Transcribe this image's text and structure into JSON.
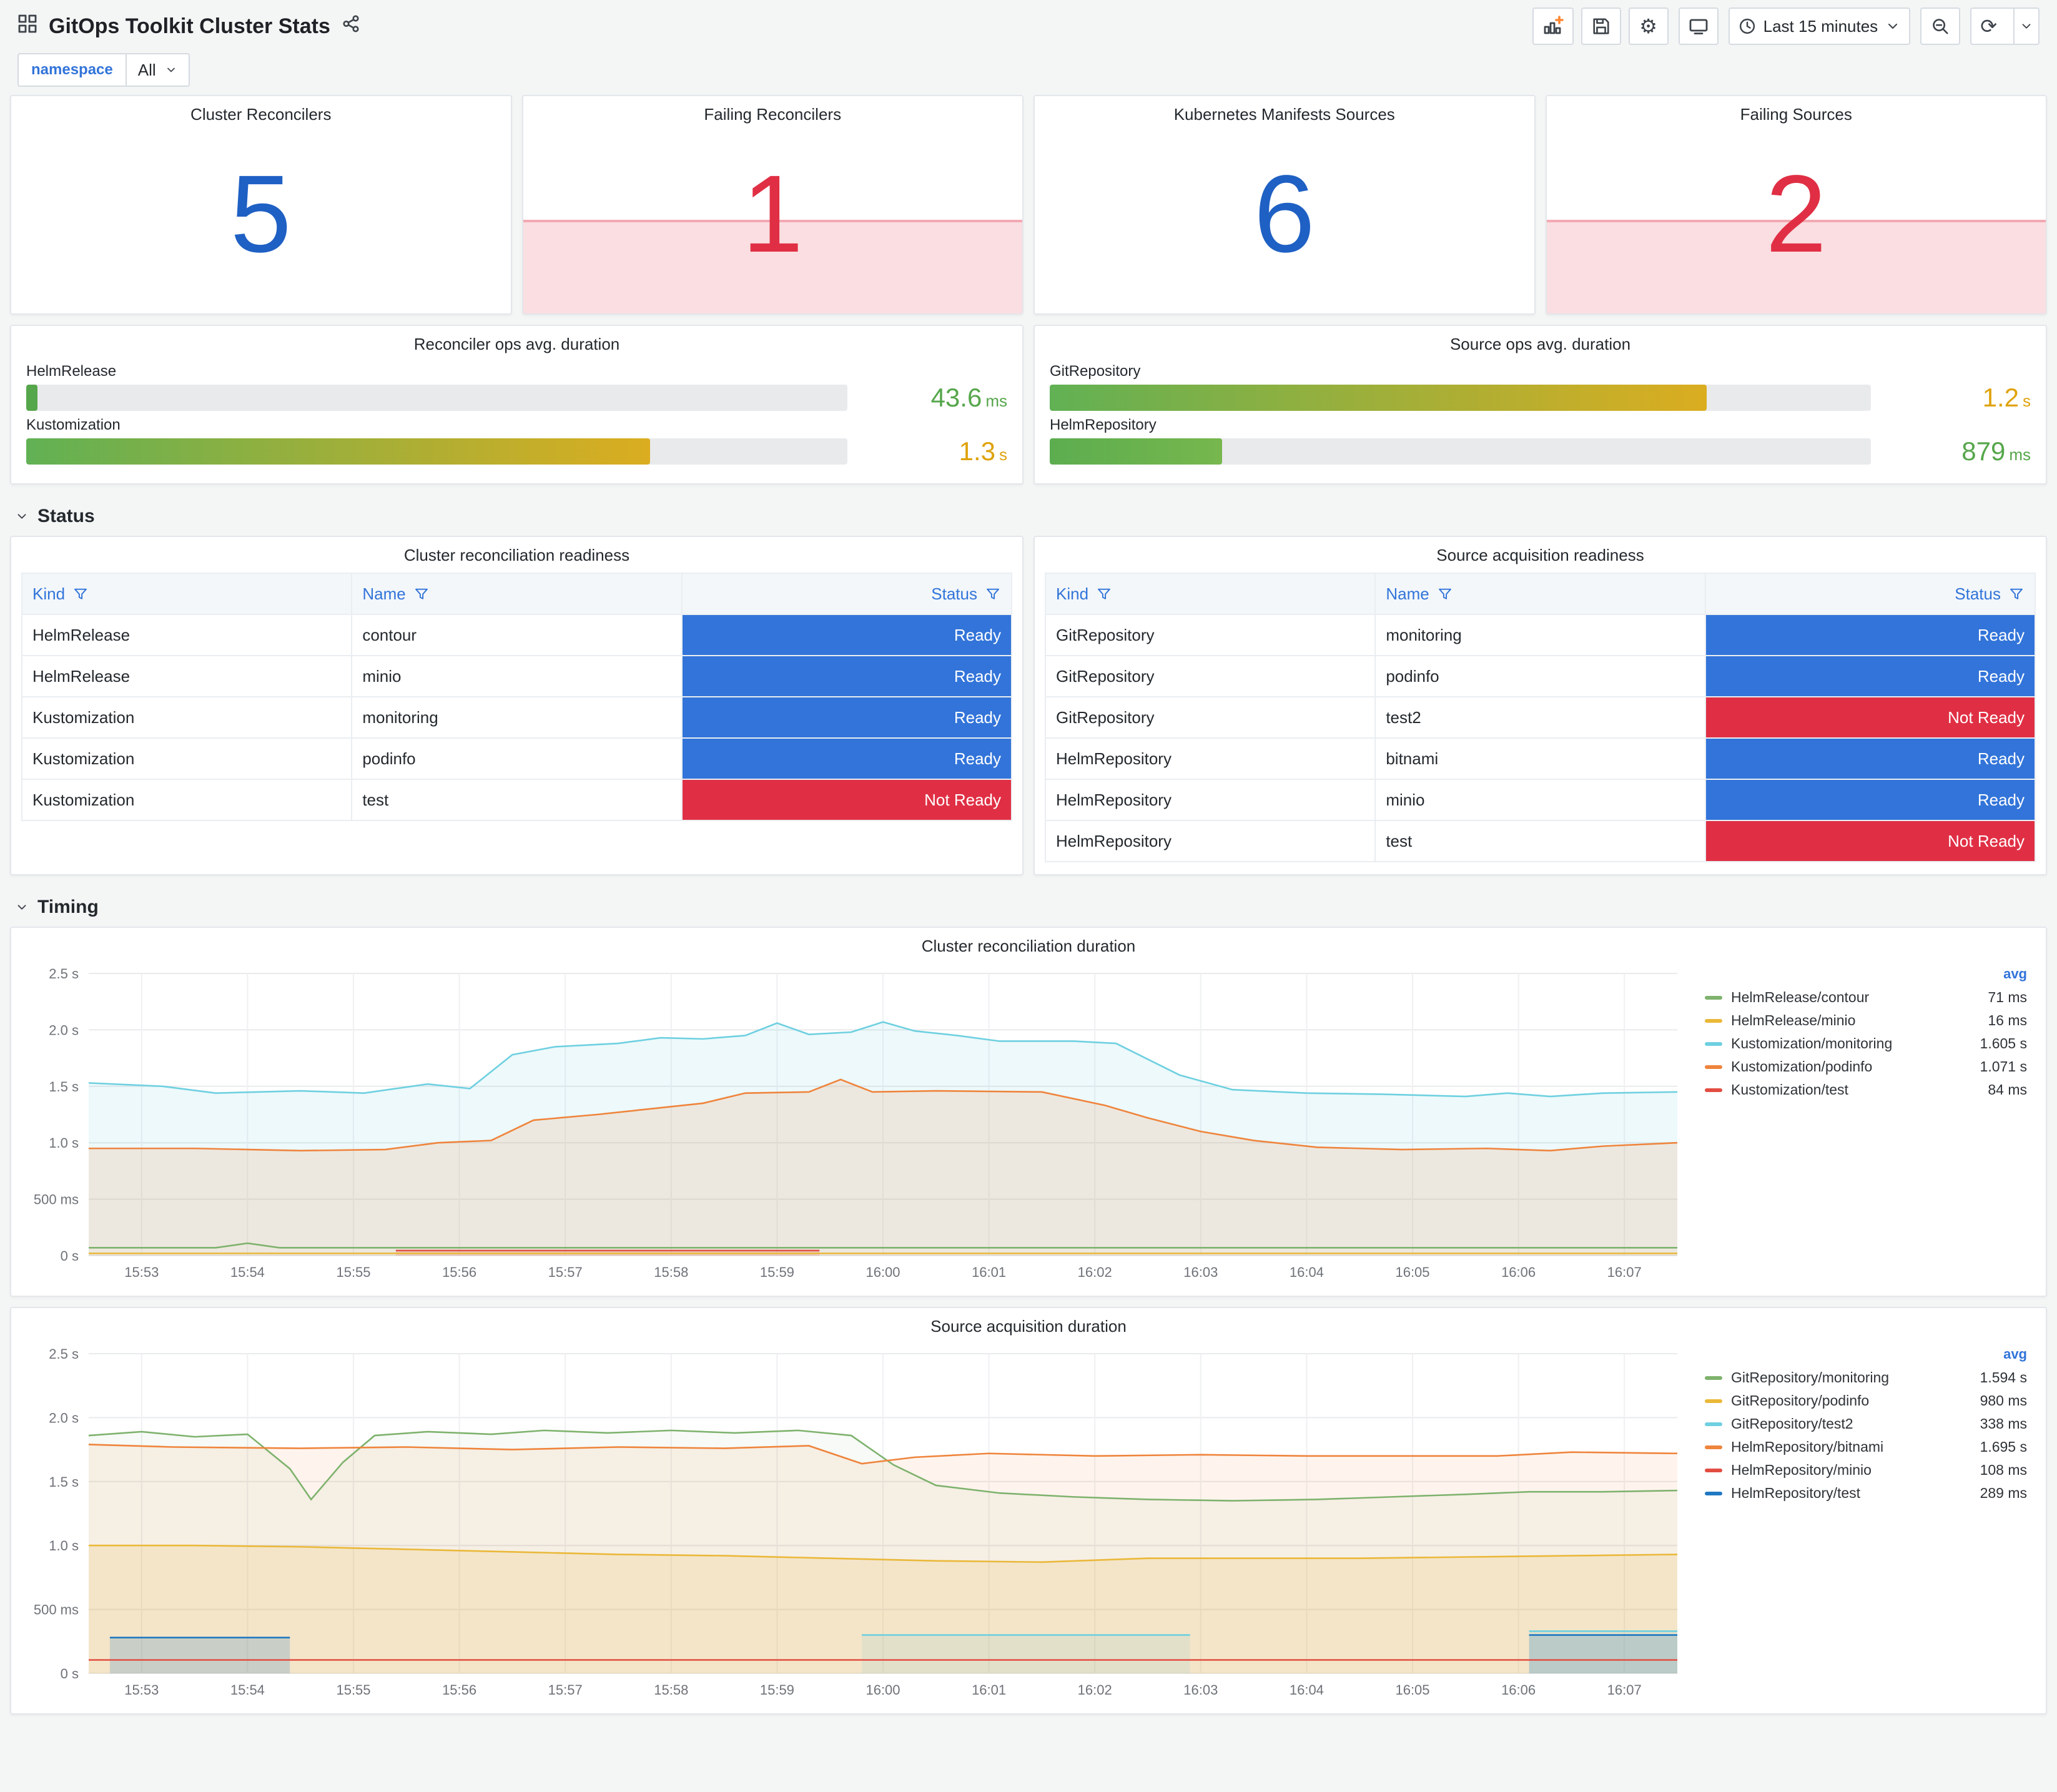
{
  "header": {
    "title": "GitOps Toolkit Cluster Stats"
  },
  "toolbar": {
    "time_range": "Last 15 minutes"
  },
  "variables": {
    "label": "namespace",
    "value": "All"
  },
  "sections": {
    "status": "Status",
    "timing": "Timing"
  },
  "icons": {
    "dashboard-icon": "▦",
    "share-icon": "⤴",
    "add-panel-icon": "📊",
    "save-icon": "💾",
    "settings-icon": "⚙",
    "tv-icon": "🖵",
    "clock-icon": "🕐",
    "chevron-down-icon": "⌄",
    "zoom-out-icon": "🔍",
    "refresh-icon": "⟳",
    "filter-icon": "▽"
  },
  "stats": [
    {
      "title": "Cluster Reconcilers",
      "value": "5",
      "state": "ok"
    },
    {
      "title": "Failing Reconcilers",
      "value": "1",
      "state": "alert"
    },
    {
      "title": "Kubernetes Manifests Sources",
      "value": "6",
      "state": "ok"
    },
    {
      "title": "Failing Sources",
      "value": "2",
      "state": "alert"
    }
  ],
  "stat_colors": {
    "ok": "#1F60C4",
    "alert": "#E02F44"
  },
  "gauges": [
    {
      "title": "Reconciler ops avg. duration",
      "rows": [
        {
          "label": "HelmRelease",
          "value": "43.6",
          "unit": "ms",
          "pct": 1.4,
          "color_from": "#56A64B",
          "color_to": "#56A64B",
          "value_color": "#56A64B"
        },
        {
          "label": "Kustomization",
          "value": "1.3",
          "unit": "s",
          "pct": 76,
          "color_from": "#61B154",
          "color_to": "#DBAD20",
          "value_color": "#DFA30C"
        }
      ]
    },
    {
      "title": "Source ops avg. duration",
      "rows": [
        {
          "label": "GitRepository",
          "value": "1.2",
          "unit": "s",
          "pct": 80,
          "color_from": "#61B154",
          "color_to": "#DBAD20",
          "value_color": "#DFA30C"
        },
        {
          "label": "HelmRepository",
          "value": "879",
          "unit": "ms",
          "pct": 21,
          "color_from": "#5CAD4F",
          "color_to": "#77B74E",
          "value_color": "#56A64B"
        }
      ]
    }
  ],
  "tables": [
    {
      "title": "Cluster reconciliation readiness",
      "columns": [
        "Kind",
        "Name",
        "Status"
      ],
      "rows": [
        [
          "HelmRelease",
          "contour",
          "Ready"
        ],
        [
          "HelmRelease",
          "minio",
          "Ready"
        ],
        [
          "Kustomization",
          "monitoring",
          "Ready"
        ],
        [
          "Kustomization",
          "podinfo",
          "Ready"
        ],
        [
          "Kustomization",
          "test",
          "Not Ready"
        ]
      ]
    },
    {
      "title": "Source acquisition readiness",
      "columns": [
        "Kind",
        "Name",
        "Status"
      ],
      "rows": [
        [
          "GitRepository",
          "monitoring",
          "Ready"
        ],
        [
          "GitRepository",
          "podinfo",
          "Ready"
        ],
        [
          "GitRepository",
          "test2",
          "Not Ready"
        ],
        [
          "HelmRepository",
          "bitnami",
          "Ready"
        ],
        [
          "HelmRepository",
          "minio",
          "Ready"
        ],
        [
          "HelmRepository",
          "test",
          "Not Ready"
        ]
      ]
    }
  ],
  "status_colors": {
    "Ready": "#3274D9",
    "Not Ready": "#E02F44"
  },
  "chart_data": [
    {
      "type": "line",
      "title": "Cluster reconciliation duration",
      "legend_header": "avg",
      "legend_position": "right",
      "grid": true,
      "ylim": [
        0,
        2.5
      ],
      "y_ticks": [
        {
          "v": 0,
          "label": "0 s"
        },
        {
          "v": 0.5,
          "label": "500 ms"
        },
        {
          "v": 1,
          "label": "1.0 s"
        },
        {
          "v": 1.5,
          "label": "1.5 s"
        },
        {
          "v": 2,
          "label": "2.0 s"
        },
        {
          "v": 2.5,
          "label": "2.5 s"
        }
      ],
      "x_tick_labels": [
        "15:53",
        "15:54",
        "15:55",
        "15:56",
        "15:57",
        "15:58",
        "15:59",
        "16:00",
        "16:01",
        "16:02",
        "16:03",
        "16:04",
        "16:05",
        "16:06",
        "16:07"
      ],
      "series": [
        {
          "name": "HelmRelease/contour",
          "color": "#7EB26D",
          "avg": "71 ms",
          "fill": 0,
          "points": [
            [
              0,
              0.07
            ],
            [
              1.2,
              0.07
            ],
            [
              1.5,
              0.11
            ],
            [
              1.8,
              0.07
            ],
            [
              8,
              0.07
            ],
            [
              15,
              0.07
            ]
          ]
        },
        {
          "name": "HelmRelease/minio",
          "color": "#EAB839",
          "avg": "16 ms",
          "fill": 0,
          "points": [
            [
              0,
              0.02
            ],
            [
              15,
              0.02
            ]
          ]
        },
        {
          "name": "Kustomization/monitoring",
          "color": "#6ED0E0",
          "avg": "1.605 s",
          "fill": 0.12,
          "points": [
            [
              0,
              1.53
            ],
            [
              0.7,
              1.5
            ],
            [
              1.2,
              1.44
            ],
            [
              2,
              1.46
            ],
            [
              2.6,
              1.44
            ],
            [
              3.2,
              1.52
            ],
            [
              3.6,
              1.48
            ],
            [
              4,
              1.78
            ],
            [
              4.4,
              1.85
            ],
            [
              5,
              1.88
            ],
            [
              5.4,
              1.93
            ],
            [
              5.8,
              1.92
            ],
            [
              6.2,
              1.95
            ],
            [
              6.5,
              2.06
            ],
            [
              6.8,
              1.96
            ],
            [
              7.2,
              1.98
            ],
            [
              7.5,
              2.07
            ],
            [
              7.8,
              1.99
            ],
            [
              8.2,
              1.95
            ],
            [
              8.6,
              1.9
            ],
            [
              9.3,
              1.9
            ],
            [
              9.7,
              1.88
            ],
            [
              10,
              1.74
            ],
            [
              10.3,
              1.6
            ],
            [
              10.8,
              1.47
            ],
            [
              11.5,
              1.44
            ],
            [
              12.2,
              1.43
            ],
            [
              13,
              1.41
            ],
            [
              13.4,
              1.44
            ],
            [
              13.8,
              1.41
            ],
            [
              14.3,
              1.44
            ],
            [
              15,
              1.45
            ]
          ]
        },
        {
          "name": "Kustomization/podinfo",
          "color": "#EF843C",
          "avg": "1.071 s",
          "fill": 0.14,
          "points": [
            [
              0,
              0.95
            ],
            [
              1,
              0.95
            ],
            [
              2,
              0.93
            ],
            [
              2.8,
              0.94
            ],
            [
              3.3,
              1.0
            ],
            [
              3.8,
              1.02
            ],
            [
              4.2,
              1.2
            ],
            [
              4.8,
              1.25
            ],
            [
              5.3,
              1.3
            ],
            [
              5.8,
              1.35
            ],
            [
              6.2,
              1.44
            ],
            [
              6.8,
              1.45
            ],
            [
              7.1,
              1.56
            ],
            [
              7.4,
              1.45
            ],
            [
              8,
              1.46
            ],
            [
              9,
              1.45
            ],
            [
              9.6,
              1.33
            ],
            [
              10,
              1.22
            ],
            [
              10.5,
              1.1
            ],
            [
              11,
              1.02
            ],
            [
              11.6,
              0.96
            ],
            [
              12.4,
              0.94
            ],
            [
              13.2,
              0.95
            ],
            [
              13.8,
              0.93
            ],
            [
              14.3,
              0.97
            ],
            [
              15,
              1.0
            ]
          ]
        },
        {
          "name": "Kustomization/test",
          "color": "#E24D42",
          "avg": "84 ms",
          "fill": 0.18,
          "points": [
            [
              2.9,
              0.045
            ],
            [
              6.9,
              0.045
            ]
          ]
        }
      ]
    },
    {
      "type": "line",
      "title": "Source acquisition duration",
      "legend_header": "avg",
      "legend_position": "right",
      "grid": true,
      "ylim": [
        0,
        2.5
      ],
      "y_ticks": [
        {
          "v": 0,
          "label": "0 s"
        },
        {
          "v": 0.5,
          "label": "500 ms"
        },
        {
          "v": 1,
          "label": "1.0 s"
        },
        {
          "v": 1.5,
          "label": "1.5 s"
        },
        {
          "v": 2,
          "label": "2.0 s"
        },
        {
          "v": 2.5,
          "label": "2.5 s"
        }
      ],
      "x_tick_labels": [
        "15:53",
        "15:54",
        "15:55",
        "15:56",
        "15:57",
        "15:58",
        "15:59",
        "16:00",
        "16:01",
        "16:02",
        "16:03",
        "16:04",
        "16:05",
        "16:06",
        "16:07"
      ],
      "series": [
        {
          "name": "GitRepository/monitoring",
          "color": "#7EB26D",
          "avg": "1.594 s",
          "fill": 0.06,
          "points": [
            [
              0,
              1.86
            ],
            [
              0.5,
              1.89
            ],
            [
              1,
              1.85
            ],
            [
              1.5,
              1.87
            ],
            [
              1.9,
              1.6
            ],
            [
              2.1,
              1.36
            ],
            [
              2.4,
              1.65
            ],
            [
              2.7,
              1.86
            ],
            [
              3.2,
              1.89
            ],
            [
              3.8,
              1.87
            ],
            [
              4.3,
              1.9
            ],
            [
              4.9,
              1.88
            ],
            [
              5.5,
              1.9
            ],
            [
              6.1,
              1.88
            ],
            [
              6.7,
              1.9
            ],
            [
              7.2,
              1.86
            ],
            [
              7.6,
              1.63
            ],
            [
              8,
              1.47
            ],
            [
              8.6,
              1.41
            ],
            [
              9.3,
              1.38
            ],
            [
              10,
              1.36
            ],
            [
              10.8,
              1.35
            ],
            [
              11.6,
              1.36
            ],
            [
              12.3,
              1.38
            ],
            [
              13,
              1.4
            ],
            [
              13.6,
              1.42
            ],
            [
              14.3,
              1.42
            ],
            [
              15,
              1.43
            ]
          ]
        },
        {
          "name": "GitRepository/podinfo",
          "color": "#EAB839",
          "avg": "980 ms",
          "fill": 0.16,
          "points": [
            [
              0,
              1.0
            ],
            [
              1,
              1.0
            ],
            [
              2,
              0.99
            ],
            [
              3,
              0.97
            ],
            [
              4,
              0.95
            ],
            [
              5,
              0.93
            ],
            [
              6,
              0.92
            ],
            [
              7,
              0.9
            ],
            [
              8,
              0.88
            ],
            [
              9,
              0.87
            ],
            [
              10,
              0.9
            ],
            [
              11,
              0.9
            ],
            [
              12,
              0.9
            ],
            [
              13,
              0.91
            ],
            [
              14,
              0.92
            ],
            [
              15,
              0.93
            ]
          ]
        },
        {
          "name": "GitRepository/test2",
          "color": "#6ED0E0",
          "avg": "338 ms",
          "fill": 0.14,
          "points": [
            [
              7.3,
              0.3
            ],
            [
              10.4,
              0.3
            ],
            [
              10.5,
              null
            ],
            [
              13.6,
              0.33
            ],
            [
              15,
              0.33
            ]
          ]
        },
        {
          "name": "HelmRepository/bitnami",
          "color": "#EF843C",
          "avg": "1.695 s",
          "fill": 0.09,
          "points": [
            [
              0,
              1.79
            ],
            [
              0.8,
              1.77
            ],
            [
              2,
              1.76
            ],
            [
              3,
              1.77
            ],
            [
              4,
              1.75
            ],
            [
              5,
              1.77
            ],
            [
              6,
              1.76
            ],
            [
              6.8,
              1.78
            ],
            [
              7.3,
              1.64
            ],
            [
              7.8,
              1.69
            ],
            [
              8.5,
              1.72
            ],
            [
              9.5,
              1.7
            ],
            [
              10.5,
              1.71
            ],
            [
              11.5,
              1.7
            ],
            [
              12.5,
              1.7
            ],
            [
              13.3,
              1.7
            ],
            [
              14,
              1.73
            ],
            [
              15,
              1.72
            ]
          ]
        },
        {
          "name": "HelmRepository/minio",
          "color": "#E24D42",
          "avg": "108 ms",
          "fill": 0,
          "points": [
            [
              0,
              0.105
            ],
            [
              15,
              0.105
            ]
          ]
        },
        {
          "name": "HelmRepository/test",
          "color": "#1F78C1",
          "avg": "289 ms",
          "fill": 0.2,
          "points": [
            [
              0.2,
              0.28
            ],
            [
              1.9,
              0.28
            ],
            [
              2,
              null
            ],
            [
              13.6,
              0.3
            ],
            [
              15,
              0.3
            ]
          ]
        }
      ]
    }
  ]
}
